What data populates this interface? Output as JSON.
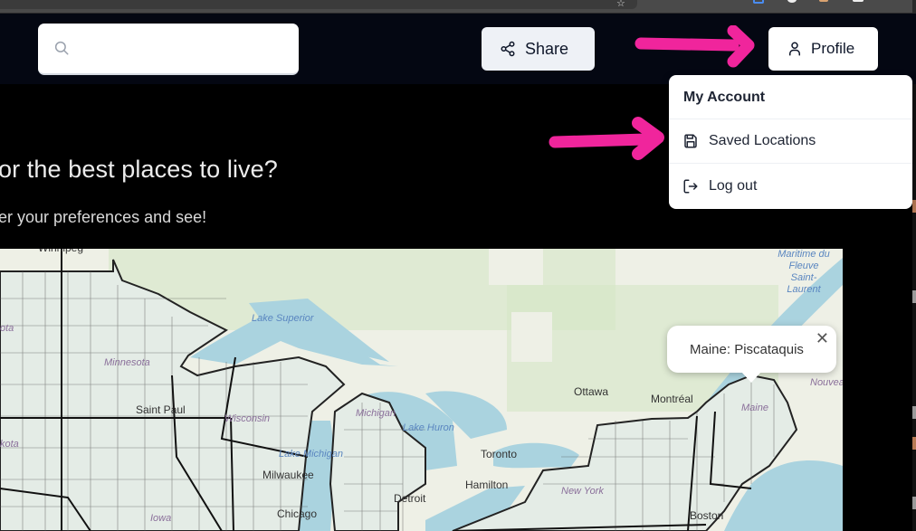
{
  "browser": {
    "bookmark_icon": "star-icon",
    "extensions": [
      "extension-icon-blue",
      "extension-icon-white",
      "extension-icon-orange",
      "extension-icon-square"
    ]
  },
  "header": {
    "search": {
      "placeholder": "",
      "value": "",
      "icon": "search-icon"
    },
    "share_button": {
      "label": "Share",
      "icon": "share-icon"
    },
    "profile_button": {
      "label": "Profile",
      "icon": "user-icon"
    }
  },
  "profile_menu": {
    "heading": "My Account",
    "items": [
      {
        "label": "Saved Locations",
        "icon": "save-icon"
      },
      {
        "label": "Log out",
        "icon": "logout-icon"
      }
    ]
  },
  "annotations": {
    "arrow_color": "#f0259c"
  },
  "hero": {
    "title": "or the best places to live?",
    "subtitle": "er your preferences and see!"
  },
  "map": {
    "popup": {
      "text": "Maine: Piscataquis",
      "close_label": "✕"
    },
    "labels": {
      "states": [
        "Minnesota",
        "Wisconsin",
        "Michigan",
        "Iowa",
        "New York",
        "Maine",
        "ota",
        "kota"
      ],
      "water": [
        "Lake Superior",
        "Lake Michigan",
        "Lake Huron",
        "Maritime du Fleuve Saint-Laurent"
      ],
      "cities": [
        "Winnipeg",
        "Saint Paul",
        "Milwaukee",
        "Chicago",
        "Detroit",
        "Toronto",
        "Hamilton",
        "Ottawa",
        "Montréal",
        "Boston"
      ],
      "region": [
        "Nouveau-Brunswick"
      ]
    }
  }
}
